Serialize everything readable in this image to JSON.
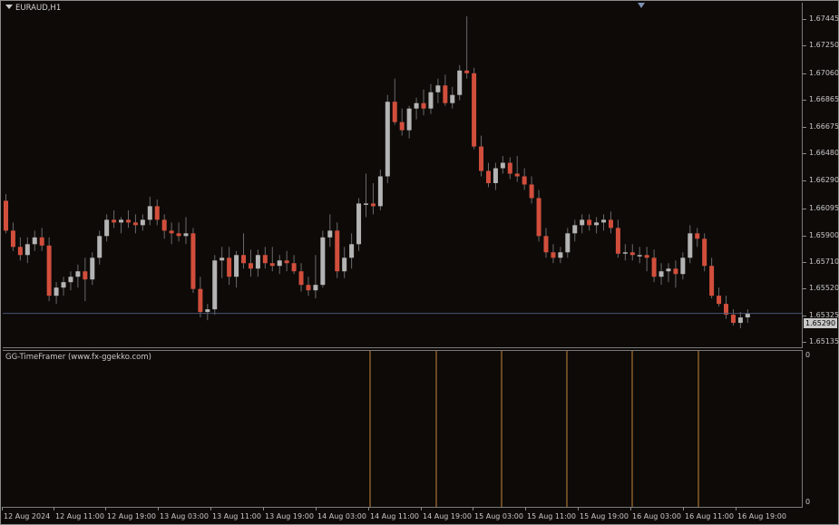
{
  "symbol": "EURAUD,H1",
  "indicator": {
    "title": "GG-TimeFramer (www.fx-ggekko.com)",
    "scale_top": "0",
    "scale_bottom": "0"
  },
  "price_axis": [
    "1.67445",
    "1.67250",
    "1.67060",
    "1.66865",
    "1.66675",
    "1.66480",
    "1.66290",
    "1.66095",
    "1.65900",
    "1.65710",
    "1.65520",
    "1.65325",
    "1.65135"
  ],
  "current_price": "1.65290",
  "time_axis": [
    "12 Aug 2024",
    "12 Aug 11:00",
    "12 Aug 19:00",
    "13 Aug 03:00",
    "13 Aug 11:00",
    "13 Aug 19:00",
    "14 Aug 03:00",
    "14 Aug 11:00",
    "14 Aug 19:00",
    "15 Aug 03:00",
    "15 Aug 11:00",
    "15 Aug 19:00",
    "16 Aug 03:00",
    "16 Aug 11:00",
    "16 Aug 19:00"
  ],
  "colors": {
    "bull": "#b4b4b4",
    "bear": "#d24e3c",
    "separator": "#c8873a",
    "price_line": "#4a5474",
    "background": "#0d0a08"
  },
  "chart_data": {
    "type": "candlestick",
    "title": "EURAUD,H1",
    "y_range": [
      1.6504,
      1.6758
    ],
    "candles": [
      [
        1.6612,
        1.6617,
        1.6588,
        1.659
      ],
      [
        1.659,
        1.6596,
        1.6575,
        1.6578
      ],
      [
        1.6578,
        1.6585,
        1.6568,
        1.6572
      ],
      [
        1.6572,
        1.6585,
        1.6566,
        1.658
      ],
      [
        1.658,
        1.659,
        1.6575,
        1.6585
      ],
      [
        1.6585,
        1.6592,
        1.6575,
        1.6579
      ],
      [
        1.6579,
        1.6585,
        1.6538,
        1.6542
      ],
      [
        1.6542,
        1.6552,
        1.6536,
        1.6548
      ],
      [
        1.6548,
        1.6556,
        1.6542,
        1.6552
      ],
      [
        1.6552,
        1.656,
        1.6546,
        1.6556
      ],
      [
        1.6556,
        1.6565,
        1.6548,
        1.656
      ],
      [
        1.656,
        1.657,
        1.6538,
        1.6554
      ],
      [
        1.6554,
        1.6574,
        1.655,
        1.657
      ],
      [
        1.657,
        1.659,
        1.6565,
        1.6586
      ],
      [
        1.6586,
        1.6602,
        1.6582,
        1.6598
      ],
      [
        1.6598,
        1.6605,
        1.6592,
        1.6596
      ],
      [
        1.6596,
        1.66,
        1.6588,
        1.6598
      ],
      [
        1.6598,
        1.6605,
        1.6592,
        1.6596
      ],
      [
        1.6596,
        1.6602,
        1.6588,
        1.6594
      ],
      [
        1.6594,
        1.6602,
        1.659,
        1.6598
      ],
      [
        1.6598,
        1.6615,
        1.6594,
        1.6608
      ],
      [
        1.6608,
        1.6613,
        1.6594,
        1.6598
      ],
      [
        1.6598,
        1.6602,
        1.6584,
        1.659
      ],
      [
        1.659,
        1.6596,
        1.658,
        1.6588
      ],
      [
        1.6588,
        1.6596,
        1.6582,
        1.6586
      ],
      [
        1.6586,
        1.66,
        1.658,
        1.6588
      ],
      [
        1.6588,
        1.6592,
        1.6544,
        1.6547
      ],
      [
        1.6547,
        1.6556,
        1.6526,
        1.653
      ],
      [
        1.653,
        1.6536,
        1.6524,
        1.6532
      ],
      [
        1.6532,
        1.6572,
        1.6528,
        1.6568
      ],
      [
        1.6568,
        1.6578,
        1.6555,
        1.657
      ],
      [
        1.657,
        1.6578,
        1.655,
        1.6556
      ],
      [
        1.6556,
        1.6575,
        1.6548,
        1.6572
      ],
      [
        1.6572,
        1.6588,
        1.6562,
        1.6566
      ],
      [
        1.6566,
        1.6576,
        1.6556,
        1.6562
      ],
      [
        1.6562,
        1.6576,
        1.6556,
        1.6572
      ],
      [
        1.6572,
        1.6578,
        1.6562,
        1.6566
      ],
      [
        1.6566,
        1.6578,
        1.656,
        1.6564
      ],
      [
        1.6564,
        1.6572,
        1.6558,
        1.6568
      ],
      [
        1.6568,
        1.6575,
        1.656,
        1.6566
      ],
      [
        1.6566,
        1.6572,
        1.6558,
        1.656
      ],
      [
        1.656,
        1.6566,
        1.6545,
        1.655
      ],
      [
        1.655,
        1.6556,
        1.6542,
        1.6546
      ],
      [
        1.6546,
        1.6572,
        1.654,
        1.655
      ],
      [
        1.655,
        1.659,
        1.6548,
        1.6585
      ],
      [
        1.6585,
        1.6602,
        1.6578,
        1.659
      ],
      [
        1.659,
        1.6596,
        1.6555,
        1.656
      ],
      [
        1.656,
        1.6578,
        1.6555,
        1.657
      ],
      [
        1.657,
        1.6588,
        1.6562,
        1.658
      ],
      [
        1.658,
        1.6614,
        1.6575,
        1.661
      ],
      [
        1.661,
        1.6632,
        1.66,
        1.661
      ],
      [
        1.661,
        1.6625,
        1.6602,
        1.6608
      ],
      [
        1.6608,
        1.6635,
        1.6605,
        1.663
      ],
      [
        1.663,
        1.669,
        1.6625,
        1.6685
      ],
      [
        1.6685,
        1.6702,
        1.6668,
        1.667
      ],
      [
        1.667,
        1.668,
        1.666,
        1.6664
      ],
      [
        1.6664,
        1.6682,
        1.6658,
        1.668
      ],
      [
        1.668,
        1.6688,
        1.6672,
        1.6684
      ],
      [
        1.6684,
        1.6694,
        1.6675,
        1.668
      ],
      [
        1.668,
        1.6698,
        1.6676,
        1.6692
      ],
      [
        1.6692,
        1.6702,
        1.6684,
        1.6697
      ],
      [
        1.6697,
        1.6705,
        1.6682,
        1.6684
      ],
      [
        1.6684,
        1.6696,
        1.668,
        1.669
      ],
      [
        1.669,
        1.6712,
        1.6686,
        1.6708
      ],
      [
        1.6708,
        1.6748,
        1.6702,
        1.6706
      ],
      [
        1.6706,
        1.671,
        1.665,
        1.6652
      ],
      [
        1.6652,
        1.666,
        1.663,
        1.6634
      ],
      [
        1.6634,
        1.664,
        1.6622,
        1.6625
      ],
      [
        1.6625,
        1.664,
        1.662,
        1.6636
      ],
      [
        1.6636,
        1.6645,
        1.6632,
        1.664
      ],
      [
        1.664,
        1.6644,
        1.6628,
        1.6632
      ],
      [
        1.6632,
        1.6645,
        1.6626,
        1.663
      ],
      [
        1.663,
        1.6636,
        1.662,
        1.6624
      ],
      [
        1.6624,
        1.663,
        1.661,
        1.6614
      ],
      [
        1.6614,
        1.662,
        1.6582,
        1.6586
      ],
      [
        1.6586,
        1.6592,
        1.657,
        1.6574
      ],
      [
        1.6574,
        1.658,
        1.6566,
        1.657
      ],
      [
        1.657,
        1.6578,
        1.6566,
        1.6574
      ],
      [
        1.6574,
        1.6592,
        1.657,
        1.6588
      ],
      [
        1.6588,
        1.6598,
        1.6582,
        1.6594
      ],
      [
        1.6594,
        1.6602,
        1.6588,
        1.6598
      ],
      [
        1.6598,
        1.6602,
        1.659,
        1.6594
      ],
      [
        1.6594,
        1.66,
        1.6588,
        1.6596
      ],
      [
        1.6596,
        1.6602,
        1.659,
        1.6598
      ],
      [
        1.6598,
        1.6604,
        1.6588,
        1.6592
      ],
      [
        1.6592,
        1.6598,
        1.657,
        1.6573
      ],
      [
        1.6573,
        1.658,
        1.6568,
        1.6574
      ],
      [
        1.6574,
        1.658,
        1.6568,
        1.6572
      ],
      [
        1.6572,
        1.6578,
        1.6566,
        1.6572
      ],
      [
        1.6572,
        1.6578,
        1.656,
        1.657
      ],
      [
        1.657,
        1.6576,
        1.6552,
        1.6556
      ],
      [
        1.6556,
        1.6566,
        1.655,
        1.656
      ],
      [
        1.656,
        1.6566,
        1.6552,
        1.6562
      ],
      [
        1.6562,
        1.6568,
        1.6548,
        1.6558
      ],
      [
        1.6558,
        1.6574,
        1.6554,
        1.657
      ],
      [
        1.657,
        1.6594,
        1.6566,
        1.6588
      ],
      [
        1.6588,
        1.6592,
        1.6578,
        1.6584
      ],
      [
        1.6584,
        1.6588,
        1.656,
        1.6564
      ],
      [
        1.6564,
        1.657,
        1.654,
        1.6542
      ],
      [
        1.6542,
        1.6548,
        1.6534,
        1.6536
      ],
      [
        1.6536,
        1.6542,
        1.6525,
        1.6528
      ],
      [
        1.6528,
        1.6532,
        1.652,
        1.6522
      ],
      [
        1.6522,
        1.653,
        1.6518,
        1.6526
      ],
      [
        1.6526,
        1.6532,
        1.6522,
        1.6529
      ]
    ],
    "last_price": 1.6529,
    "indicator_zero_line": 0
  }
}
